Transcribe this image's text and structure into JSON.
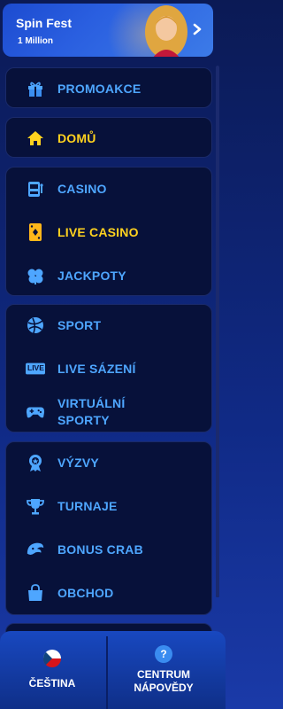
{
  "banner": {
    "title": "Spin Fest",
    "subtitle": "1 Million",
    "arrow_icon": "chevron-right-icon"
  },
  "groups": [
    {
      "items": [
        {
          "label": "PROMOAKCE",
          "icon": "gift-icon",
          "color": "#4ea6ff"
        }
      ]
    },
    {
      "items": [
        {
          "label": "DOMŮ",
          "icon": "home-icon",
          "color": "#ffd21f"
        }
      ]
    },
    {
      "items": [
        {
          "label": "CASINO",
          "icon": "slot-machine-icon",
          "color": "#4ea6ff"
        },
        {
          "label": "LIVE CASINO",
          "icon": "playing-card-icon",
          "color": "#ffd21f"
        },
        {
          "label": "JACKPOTY",
          "icon": "clover-icon",
          "color": "#4ea6ff"
        }
      ]
    },
    {
      "items": [
        {
          "label": "SPORT",
          "icon": "sport-ball-icon",
          "color": "#4ea6ff"
        },
        {
          "label": "LIVE SÁZENÍ",
          "icon": "live-badge-icon",
          "badge": "LIVE",
          "color": "#4ea6ff"
        },
        {
          "label_line1": "VIRTUÁLNÍ",
          "label_line2": "SPORTY",
          "icon": "gamepad-icon",
          "color": "#4ea6ff"
        }
      ]
    },
    {
      "items": [
        {
          "label": "VÝZVY",
          "icon": "medal-icon",
          "color": "#4ea6ff"
        },
        {
          "label": "TURNAJE",
          "icon": "trophy-icon",
          "color": "#4ea6ff"
        },
        {
          "label": "BONUS CRAB",
          "icon": "crab-claw-icon",
          "color": "#4ea6ff"
        },
        {
          "label": "OBCHOD",
          "icon": "shopping-bag-icon",
          "color": "#4ea6ff"
        }
      ]
    }
  ],
  "bottom": {
    "language": {
      "label": "ČEŠTINA",
      "icon": "czech-flag-icon"
    },
    "help": {
      "line1": "CENTRUM",
      "line2": "NÁPOVĚDY",
      "icon": "help-icon",
      "glyph": "?"
    }
  }
}
